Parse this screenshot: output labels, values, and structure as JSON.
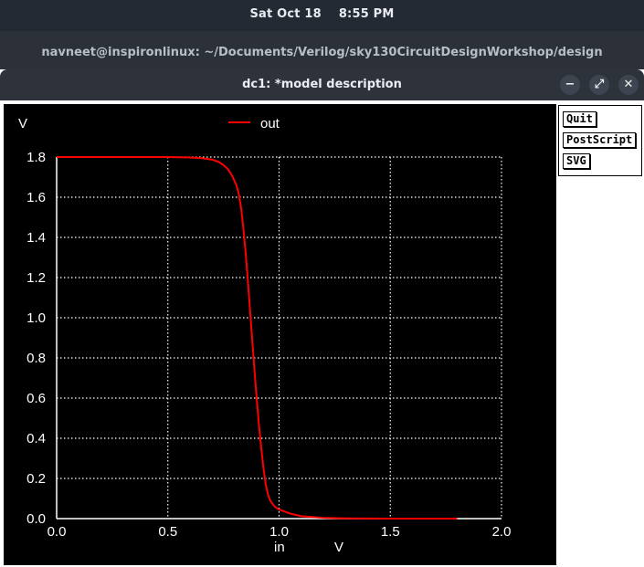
{
  "topbar": {
    "date": "Sat Oct 18",
    "time": "8:55 PM"
  },
  "terminal": {
    "title": "navneet@inspironlinux: ~/Documents/Verilog/sky130CircuitDesignWorkshop/design"
  },
  "window": {
    "title": "dc1: *model description",
    "minimize": "−",
    "maximize": "⤢",
    "close": "✕"
  },
  "side_buttons": {
    "quit": "Quit",
    "postscript": "PostScript",
    "svg": "SVG"
  },
  "chart_data": {
    "type": "line",
    "ylabel": "V",
    "xlabel": "in",
    "xunit": "V",
    "xlim": [
      0.0,
      2.0
    ],
    "ylim": [
      0.0,
      1.8
    ],
    "xticks": [
      "0.0",
      "0.5",
      "1.0",
      "1.5",
      "2.0"
    ],
    "yticks": [
      "0.0",
      "0.2",
      "0.4",
      "0.6",
      "0.8",
      "1.0",
      "1.2",
      "1.4",
      "1.6",
      "1.8"
    ],
    "grid": true,
    "legend": "top-center",
    "series": [
      {
        "name": "out",
        "color": "#ff0000",
        "x": [
          0.0,
          0.5,
          0.6,
          0.65,
          0.7,
          0.73,
          0.75,
          0.77,
          0.79,
          0.81,
          0.82,
          0.83,
          0.84,
          0.85,
          0.86,
          0.87,
          0.88,
          0.89,
          0.9,
          0.91,
          0.92,
          0.93,
          0.94,
          0.95,
          0.96,
          0.98,
          1.0,
          1.05,
          1.1,
          1.2,
          1.3,
          1.5,
          1.8
        ],
        "y": [
          1.8,
          1.8,
          1.798,
          1.795,
          1.787,
          1.775,
          1.76,
          1.74,
          1.705,
          1.655,
          1.61,
          1.54,
          1.44,
          1.32,
          1.18,
          1.03,
          0.88,
          0.73,
          0.59,
          0.46,
          0.35,
          0.25,
          0.17,
          0.12,
          0.09,
          0.06,
          0.045,
          0.025,
          0.012,
          0.004,
          0.001,
          0.0,
          0.0
        ]
      }
    ]
  }
}
